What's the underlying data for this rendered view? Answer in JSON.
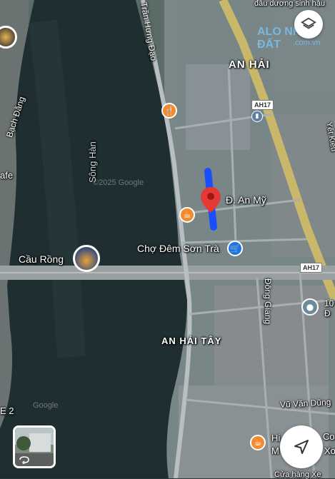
{
  "place_labels": {
    "an_hai": "AN HẢI",
    "an_hai_tay": "AN HẢI TÂY"
  },
  "streets": {
    "tran_hung_dao": "Trần Hưng Đạo",
    "bach_dang": "Bạch Đằng",
    "an_my": "Đ. An Mỹ",
    "dong_giang": "Đông Giang",
    "vu_van_dung": "Vũ Văn Dũng",
    "top_partial": "đầu dương sinh hậu",
    "right_partial": "Yết Kiêu",
    "bottom_partial": "Cửa hàng Xe",
    "left_e2": "E 2",
    "left_cafe": "afe"
  },
  "water": {
    "song_han": "Sông Hàn",
    "copyright_1": "©2025 Google",
    "copyright_2": "©2025 Google",
    "copyright_3": "Google"
  },
  "pois": {
    "cau_rong": "Cầu Rồng",
    "cho_dem_son_tra": "Chợ Đêm Sơn Trà",
    "right_cut_1": "10",
    "right_cut_2": "Đ",
    "right_cut_3": "Hi",
    "right_cut_4": "M",
    "right_cut_5": "Co",
    "right_cut_6": "Xo"
  },
  "highways": {
    "ah17_top": "AH17",
    "ah17_bridge": "AH17"
  },
  "watermark": {
    "brand": "ALO NHÀ ĐẤT",
    "domain": ".com.vn"
  },
  "icons": {
    "layers": "layers-icon",
    "navigate": "navigation-arrow-icon",
    "street_view_toggle": "rotate-icon"
  },
  "colors": {
    "route": "#1a4fff",
    "pin": "#e53935",
    "poi_food": "#f28b30",
    "poi_shop": "#1a73e8",
    "poi_gray": "#4d6a7a"
  }
}
